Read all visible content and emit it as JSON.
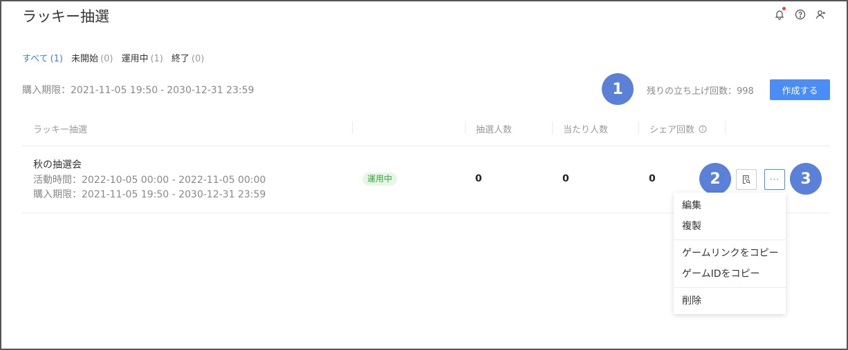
{
  "page": {
    "title": "ラッキー抽選"
  },
  "header_icons": [
    "bell-icon",
    "help-icon",
    "user-switch-icon"
  ],
  "tabs": [
    {
      "label": "すべて",
      "count": "(1)",
      "active": true
    },
    {
      "label": "未開始",
      "count": "(0)",
      "active": false
    },
    {
      "label": "運用中",
      "count": "(1)",
      "active": false
    },
    {
      "label": "終了",
      "count": "(0)",
      "active": false
    }
  ],
  "purchase_period": {
    "label": "購入期限：",
    "start": "2021-11-05 19:50",
    "sep": "-",
    "end": "2030-12-31 23:59"
  },
  "remaining": {
    "text": "残りの立ち上げ回数：998"
  },
  "create_button": "作成する",
  "annotations": {
    "b1": "1",
    "b2": "2",
    "b3": "3"
  },
  "table": {
    "headers": {
      "name": "ラッキー抽選",
      "participants": "抽選人数",
      "winners": "当たり人数",
      "shares": "シェア回数"
    },
    "rows": [
      {
        "name": "秋の抽選会",
        "activity_period": "活動時間：2022-10-05 00:00 - 2022-11-05 00:00",
        "purchase_period": "購入期限：2021-11-05 19:50 - 2030-12-31 23:59",
        "status": "運用中",
        "participants": "0",
        "winners": "0",
        "shares": "0"
      }
    ]
  },
  "more_label": "···",
  "dropdown": {
    "edit": "編集",
    "duplicate": "複製",
    "copy_game_link": "ゲームリンクをコピー",
    "copy_game_id": "ゲームIDをコピー",
    "delete": "削除"
  },
  "colors": {
    "accent": "#4a8df6",
    "badge": "#5b80d8",
    "status_bg": "#e8f6e8",
    "status_text": "#3aa23a",
    "notif_dot": "#f0413e"
  }
}
